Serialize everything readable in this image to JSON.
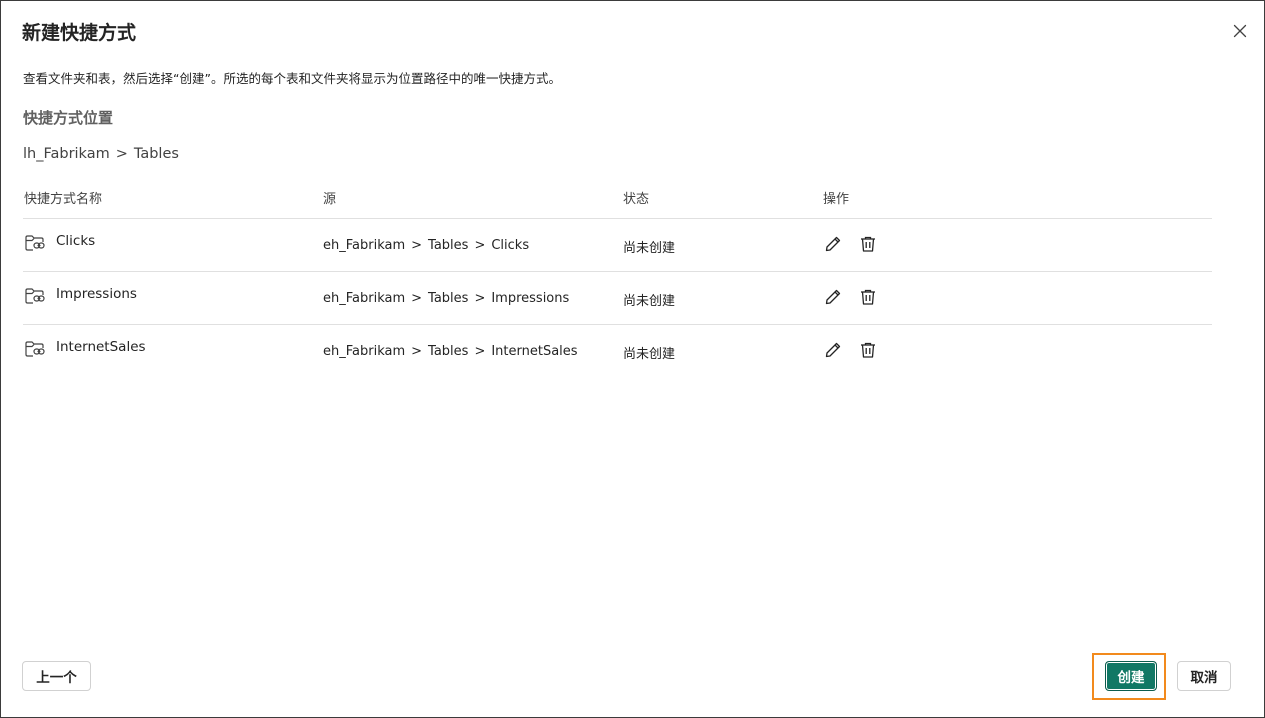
{
  "dialog": {
    "title": "新建快捷方式",
    "description": "查看文件夹和表，然后选择“创建”。所选的每个表和文件夹将显示为位置路径中的唯一快捷方式。",
    "location_label": "快捷方式位置",
    "location_path": [
      "lh_Fabrikam",
      "Tables"
    ],
    "path_separator": ">"
  },
  "table": {
    "headers": {
      "name": "快捷方式名称",
      "source": "源",
      "status": "状态",
      "actions": "操作"
    },
    "rows": [
      {
        "name": "Clicks",
        "source": [
          "eh_Fabrikam",
          "Tables",
          "Clicks"
        ],
        "status": "尚未创建",
        "icon": "folder-link-icon"
      },
      {
        "name": "Impressions",
        "source": [
          "eh_Fabrikam",
          "Tables",
          "Impressions"
        ],
        "status": "尚未创建",
        "icon": "folder-link-icon"
      },
      {
        "name": "InternetSales",
        "source": [
          "eh_Fabrikam",
          "Tables",
          "InternetSales"
        ],
        "status": "尚未创建",
        "icon": "folder-link-icon"
      }
    ],
    "row_actions": [
      "edit-icon",
      "delete-icon"
    ]
  },
  "footer": {
    "prev_label": "上一个",
    "create_label": "创建",
    "cancel_label": "取消"
  },
  "colors": {
    "primary": "#117865",
    "highlight": "#f28a1d",
    "border": "#3b3b3b",
    "divider": "#e0e0e0"
  }
}
